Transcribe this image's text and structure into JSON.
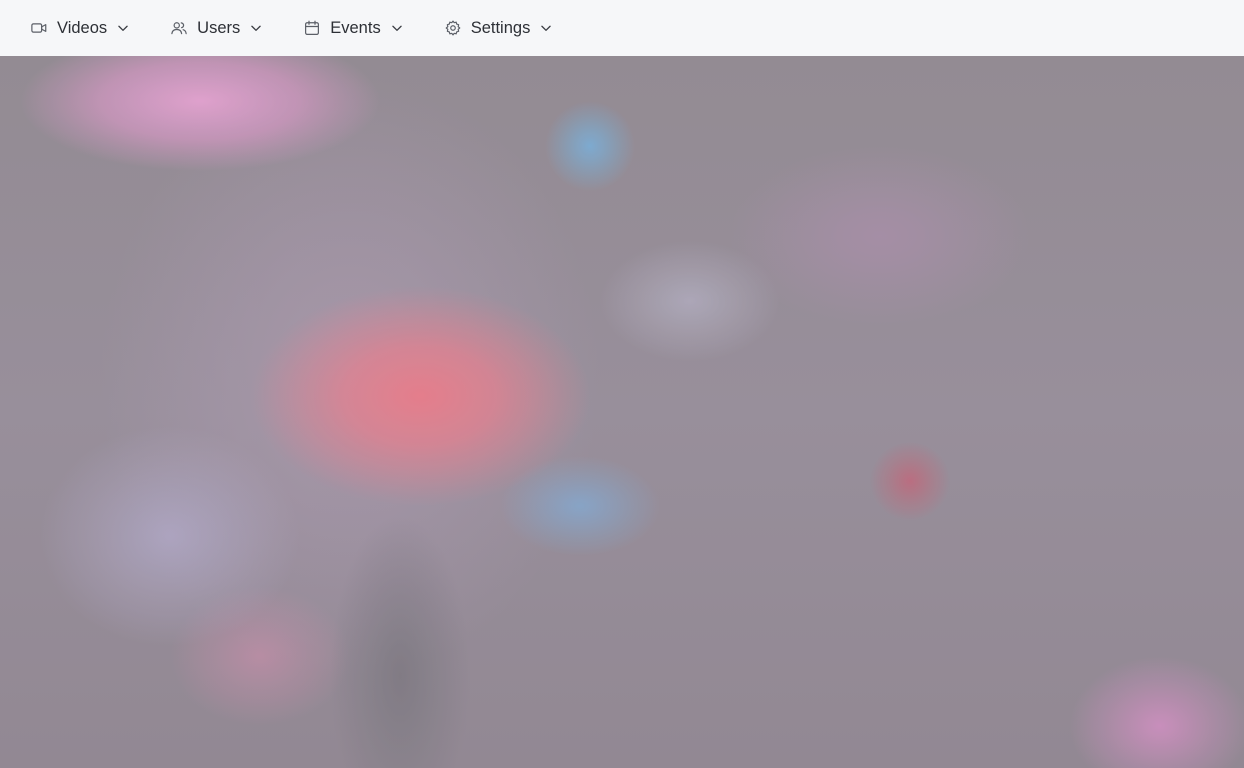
{
  "nav": {
    "items": [
      {
        "label": "Videos",
        "icon": "video-camera-icon"
      },
      {
        "label": "Users",
        "icon": "users-icon"
      },
      {
        "label": "Events",
        "icon": "calendar-icon"
      },
      {
        "label": "Settings",
        "icon": "gear-icon"
      }
    ]
  },
  "colors": {
    "topbar_background": "#f6f7f9",
    "text": "#2d3036",
    "icon": "#5b5f67"
  }
}
